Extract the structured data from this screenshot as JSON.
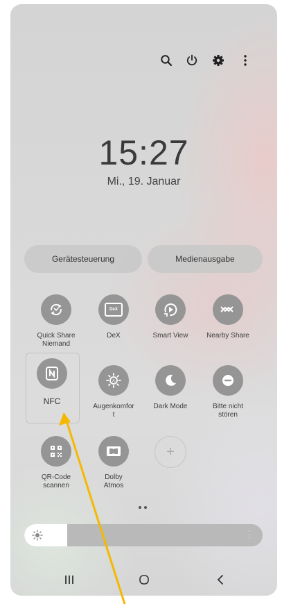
{
  "status": {
    "time": "15:27",
    "date": "Mi., 19. Januar"
  },
  "top_icons": [
    "search-icon",
    "power-icon",
    "settings-gear-icon",
    "more-options-icon"
  ],
  "pills": {
    "device_control": "Gerätesteuerung",
    "media_output": "Medienausgabe"
  },
  "tiles": {
    "quick_share": "Quick Share\nNiemand",
    "dex": "DeX",
    "dex_badge": "DeX",
    "smart_view": "Smart View",
    "nearby_share": "Nearby Share",
    "nfc": "NFC",
    "eye_comfort": "Augenkomfor\nt",
    "dark_mode": "Dark Mode",
    "do_not_disturb": "Bitte nicht\nstören",
    "qr_code": "QR-Code\nscannen",
    "dolby": "Dolby\nAtmos",
    "add": "+"
  },
  "brightness": {
    "level_fraction": 0.18
  },
  "nav": {
    "recents": "recents-icon",
    "home": "home-icon",
    "back": "back-icon"
  },
  "colors": {
    "arrow": "#f5b800",
    "tile_dark": "#959595",
    "tile_light": "#e4e4e4"
  }
}
